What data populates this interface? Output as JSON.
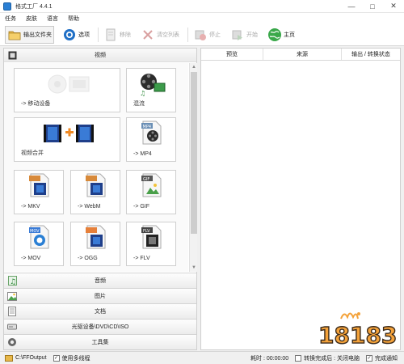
{
  "window": {
    "title": "格式工厂 4.4.1"
  },
  "menu": [
    "任务",
    "皮肤",
    "语言",
    "帮助"
  ],
  "toolbar": {
    "output_folder": "输出文件夹",
    "options": "选项",
    "remove": "移除",
    "clear_list": "清空列表",
    "stop": "停止",
    "start": "开始",
    "home": "主页"
  },
  "left": {
    "video_header": "视频",
    "tiles": [
      {
        "label": "-> 移动设备"
      },
      {
        "label": "混流"
      },
      {
        "label": "视频合并"
      },
      {
        "label": "-> MP4"
      },
      {
        "label": "-> MKV"
      },
      {
        "label": "-> WebM"
      },
      {
        "label": "-> GIF"
      },
      {
        "label": "-> MOV"
      },
      {
        "label": "-> OGG"
      },
      {
        "label": "-> FLV"
      }
    ],
    "categories": [
      "音频",
      "图片",
      "文档",
      "光驱设备\\DVD\\CD\\ISO",
      "工具集"
    ]
  },
  "right": {
    "columns": [
      "预览",
      "来源",
      "输出 / 转换状态"
    ]
  },
  "status": {
    "output_path": "C:\\FFOutput",
    "multithread": "使用多线程",
    "elapsed": "耗时 : 00:00:00",
    "after_done": "转换完成后 : 关闭电脑",
    "notify": "完成通知"
  },
  "watermark": {
    "text": "18183"
  },
  "colors": {
    "accent_blue": "#2a7fd4",
    "watermark_orange": "#f4a23a",
    "watermark_outline": "#3b2a1a"
  }
}
